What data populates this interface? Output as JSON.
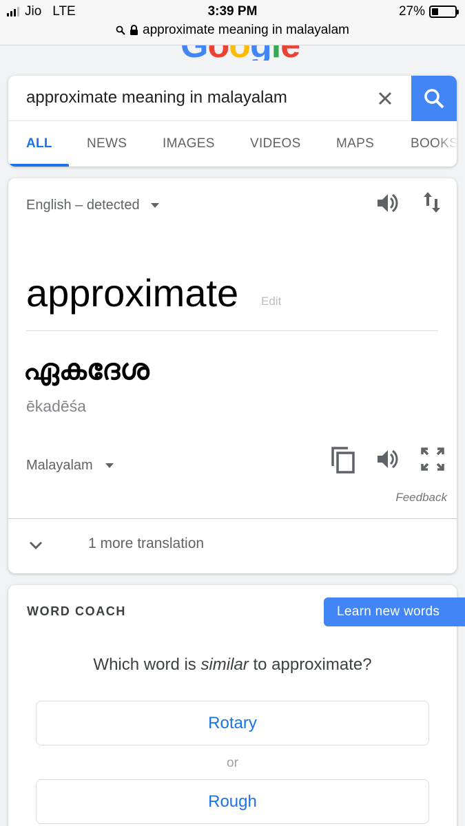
{
  "status_bar": {
    "carrier": "Jio",
    "network": "LTE",
    "time": "3:39 PM",
    "battery": "27%",
    "battery_level": 0.27,
    "url": "approximate meaning in malayalam"
  },
  "search": {
    "query": "approximate meaning in malayalam",
    "tabs": [
      "ALL",
      "NEWS",
      "IMAGES",
      "VIDEOS",
      "MAPS",
      "BOOKS"
    ],
    "active_tab": "ALL"
  },
  "translate": {
    "source_language": "English – detected",
    "source_word": "approximate",
    "edit_label": "Edit",
    "target_word": "ഏകദേശ",
    "transliteration": "ēkadēśa",
    "target_language": "Malayalam",
    "feedback_label": "Feedback",
    "more_translations": "1 more translation"
  },
  "word_coach": {
    "title": "WORD COACH",
    "learn_button": "Learn new words",
    "question_prefix": "Which word is ",
    "question_emphasis": "similar",
    "question_suffix": " to approximate?",
    "options": [
      "Rotary",
      "Rough"
    ],
    "or_label": "or"
  },
  "colors": {
    "accent_blue": "#4285f4",
    "link_blue": "#1a73e8"
  },
  "icons": [
    "search-icon",
    "lock-icon",
    "clear-icon",
    "speaker-icon",
    "swap-icon",
    "copy-icon",
    "fullscreen-icon",
    "chevron-down-icon"
  ]
}
